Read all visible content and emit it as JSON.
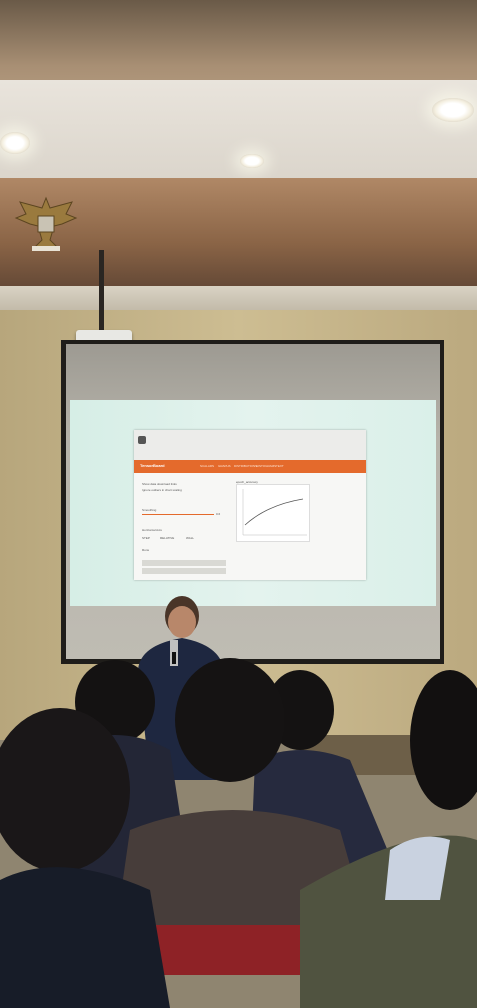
{
  "scene": {
    "description_tags": [
      "presentation",
      "projector-screen",
      "audience",
      "speaker"
    ],
    "colors": {
      "accent_orange": "#e46a2c",
      "projection_bg": "#d9efe8",
      "wall": "#c6b68b"
    }
  },
  "slide": {
    "app_title": "TensorBoard",
    "tabs": [
      "SCALARS",
      "GRAPHS",
      "DISTRIBUTIONS",
      "HISTOGRAMS",
      "TEXT"
    ],
    "options": [
      "Show data download links",
      "Ignore outliers in chart scaling"
    ],
    "smoothing_label": "Smoothing",
    "smoothing_value": "0.6",
    "horizontal_axis_label": "Horizontal Axis",
    "axis_options": [
      "STEP",
      "RELATIVE",
      "WALL"
    ],
    "runs_label": "Runs",
    "chart_label": "epoch_accuracy"
  }
}
